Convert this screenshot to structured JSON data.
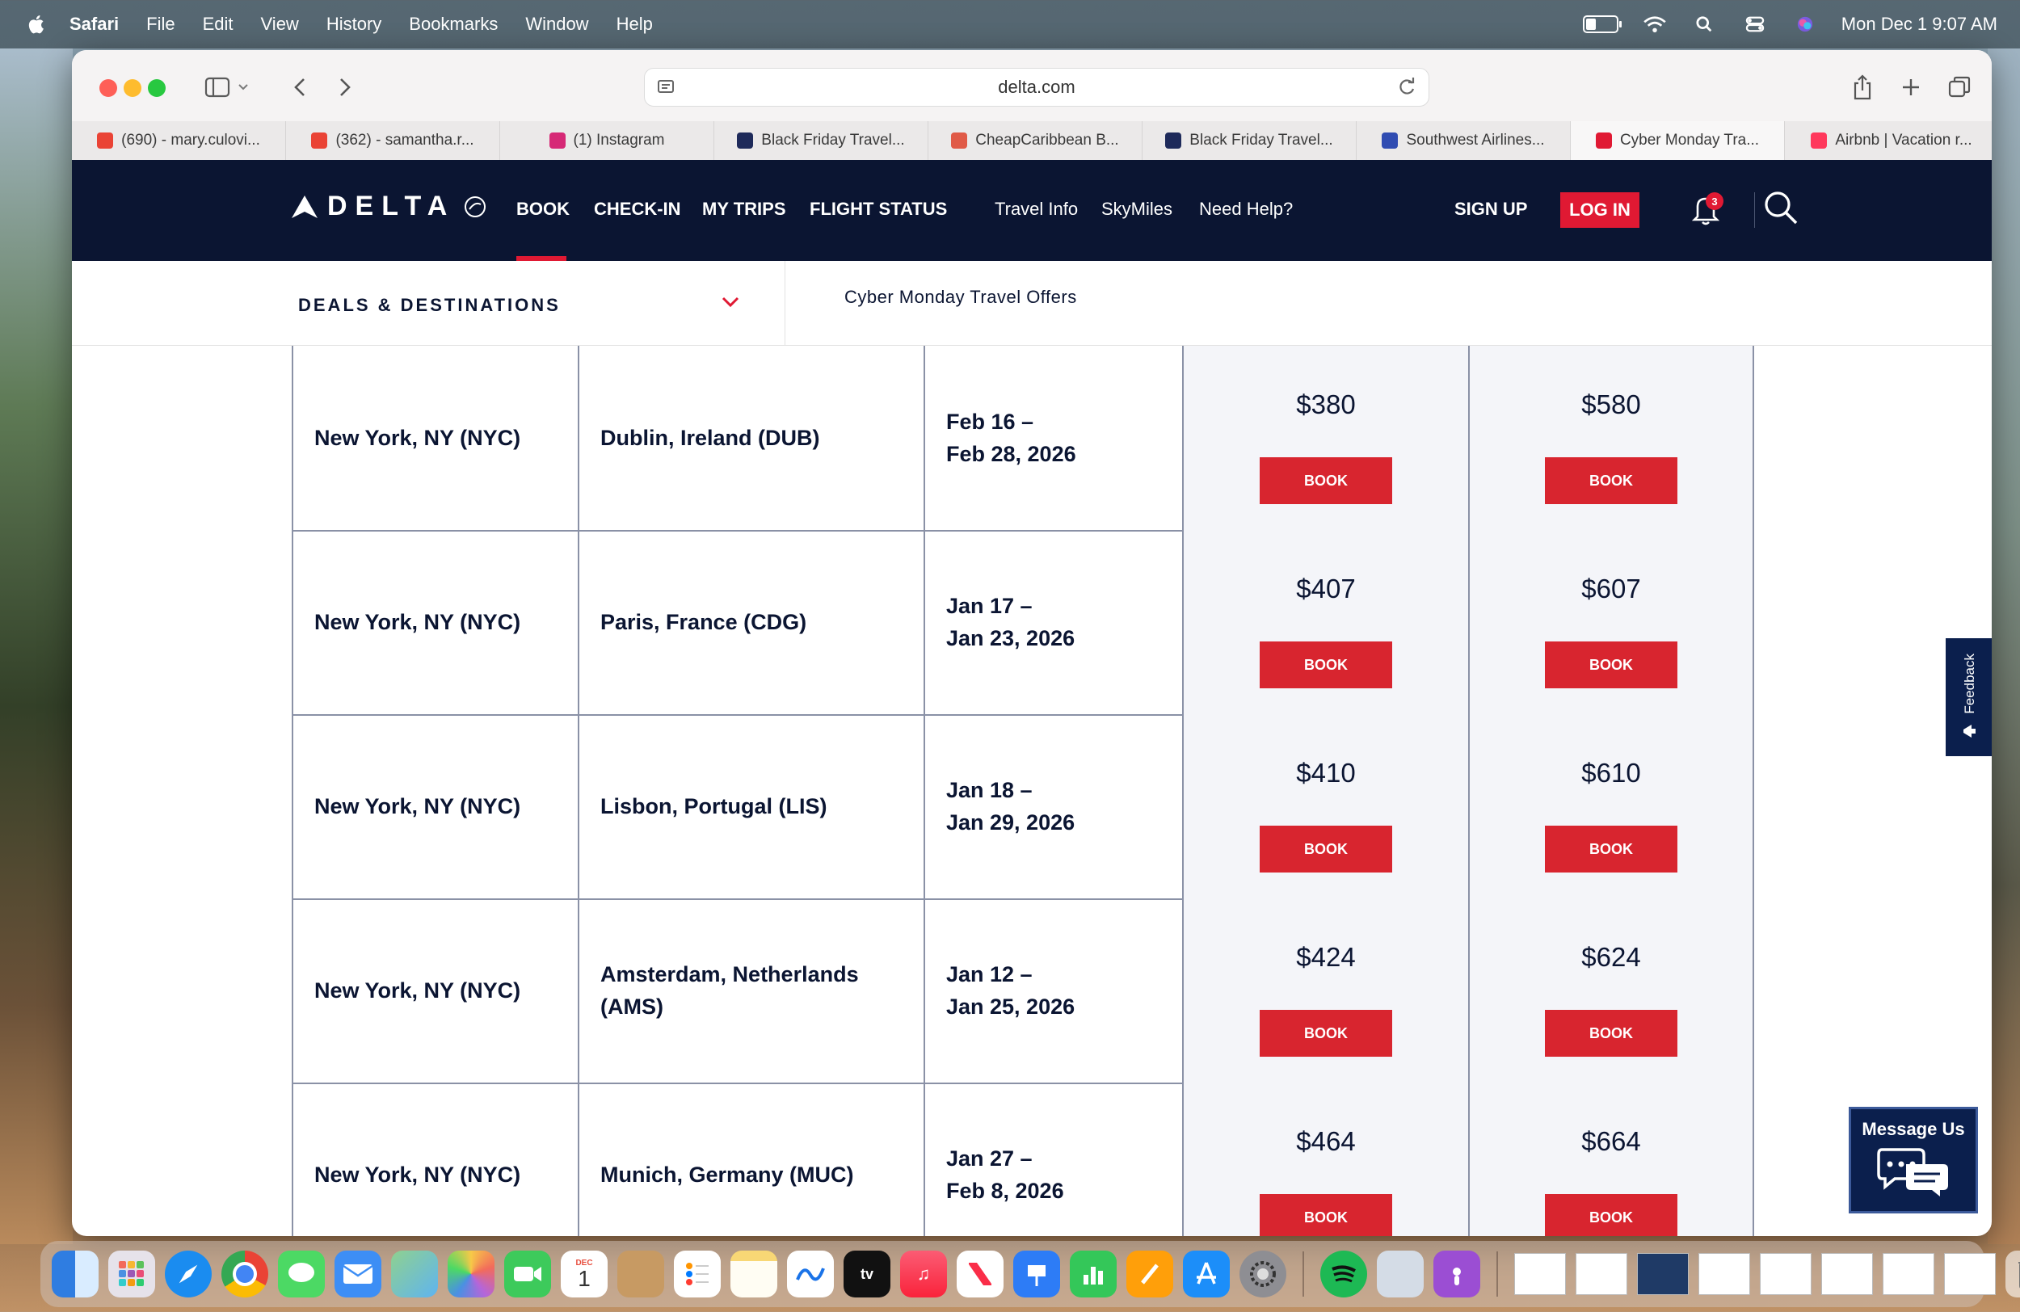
{
  "menubar": {
    "app": "Safari",
    "items": [
      "File",
      "Edit",
      "View",
      "History",
      "Bookmarks",
      "Window",
      "Help"
    ],
    "datetime": "Mon Dec 1  9:07 AM"
  },
  "browser": {
    "url": "delta.com",
    "tabs": [
      {
        "label": "(690) - mary.culovi...",
        "icon": "gmail-icon",
        "color": "#ea4335"
      },
      {
        "label": "(362) - samantha.r...",
        "icon": "gmail-icon",
        "color": "#ea4335"
      },
      {
        "label": "(1) Instagram",
        "icon": "instagram-icon",
        "color": "#d62976"
      },
      {
        "label": "Black Friday Travel...",
        "icon": "site-icon",
        "color": "#1e2a5a"
      },
      {
        "label": "CheapCaribbean B...",
        "icon": "umbrella-icon",
        "color": "#e05a47"
      },
      {
        "label": "Black Friday Travel...",
        "icon": "site-icon",
        "color": "#1e2a5a"
      },
      {
        "label": "Southwest Airlines...",
        "icon": "heart-icon",
        "color": "#304cb2"
      },
      {
        "label": "Cyber Monday Tra...",
        "icon": "delta-icon",
        "color": "#e01933"
      },
      {
        "label": "Airbnb | Vacation r...",
        "icon": "airbnb-icon",
        "color": "#ff385c"
      }
    ]
  },
  "delta_nav": {
    "logo": "DELTA",
    "book": "BOOK",
    "checkin": "CHECK-IN",
    "mytrips": "MY TRIPS",
    "flightstatus": "FLIGHT STATUS",
    "travelinfo": "Travel Info",
    "skymiles": "SkyMiles",
    "needhelp": "Need Help?",
    "signup": "SIGN UP",
    "login": "LOG IN",
    "notification_count": "3"
  },
  "subnav": {
    "deals": "DEALS & DESTINATIONS",
    "title": "Cyber Monday Travel Offers"
  },
  "table": {
    "rows": [
      {
        "origin": "New York, NY (NYC)",
        "destination": "Dublin, Ireland (DUB)",
        "dates_1": "Feb 16 –",
        "dates_2": "Feb 28, 2026",
        "price_1": "$380",
        "price_2": "$580",
        "book": "BOOK"
      },
      {
        "origin": "New York, NY (NYC)",
        "destination": "Paris, France (CDG)",
        "dates_1": "Jan 17 –",
        "dates_2": "Jan 23, 2026",
        "price_1": "$407",
        "price_2": "$607",
        "book": "BOOK"
      },
      {
        "origin": "New York, NY (NYC)",
        "destination": "Lisbon, Portugal (LIS)",
        "dates_1": "Jan 18 –",
        "dates_2": "Jan 29, 2026",
        "price_1": "$410",
        "price_2": "$610",
        "book": "BOOK"
      },
      {
        "origin": "New York, NY (NYC)",
        "destination": "Amsterdam, Netherlands (AMS)",
        "dates_1": "Jan 12 –",
        "dates_2": "Jan 25, 2026",
        "price_1": "$424",
        "price_2": "$624",
        "book": "BOOK"
      },
      {
        "origin": "New York, NY (NYC)",
        "destination": "Munich, Germany (MUC)",
        "dates_1": "Jan 27 –",
        "dates_2": "Feb 8, 2026",
        "price_1": "$464",
        "price_2": "$664",
        "book": "BOOK"
      }
    ]
  },
  "widgets": {
    "feedback": "Feedback",
    "message": "Message Us"
  },
  "dock": {
    "calendar_month": "DEC",
    "calendar_day": "1",
    "apps": [
      "finder-icon",
      "launchpad-icon",
      "safari-icon",
      "chrome-icon",
      "messages-icon",
      "mail-icon",
      "maps-icon",
      "photos-icon",
      "facetime-icon",
      "calendar-icon",
      "contacts-icon",
      "reminders-icon",
      "notes-icon",
      "freeform-icon",
      "tv-icon",
      "music-icon",
      "news-icon",
      "keynote-icon",
      "numbers-icon",
      "pages-icon",
      "appstore-icon",
      "settings-icon"
    ]
  },
  "colors": {
    "delta_navy": "#0b1532",
    "delta_red": "#e01933",
    "book_red": "#d8252f"
  }
}
